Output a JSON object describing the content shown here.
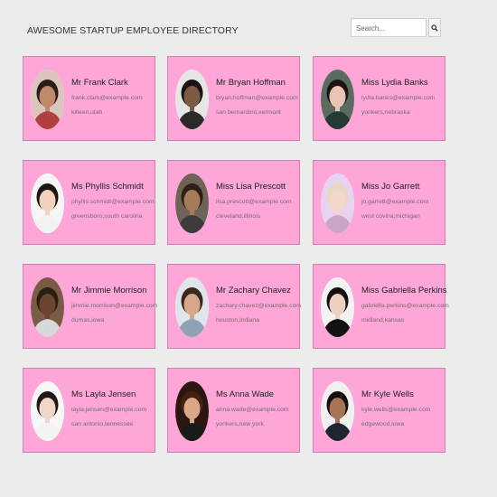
{
  "header": {
    "title": "AWESOME STARTUP EMPLOYEE DIRECTORY",
    "search_placeholder": "Search...",
    "search_icon": "magnifier-icon"
  },
  "employees": [
    {
      "name": "Mr Frank Clark",
      "email": "frank.clark@example.com",
      "location": "killeen,utah",
      "skin": "#c08a6a",
      "hair": "#2a1b14",
      "shirt": "#b04040",
      "bg": "#d9c6bd"
    },
    {
      "name": "Mr Bryan Hoffman",
      "email": "bryan.hoffman@example.com",
      "location": "san bernardino,vermont",
      "skin": "#7d5a44",
      "hair": "#181210",
      "shirt": "#2a2a2a",
      "bg": "#e6e6e6"
    },
    {
      "name": "Miss Lydia Banks",
      "email": "lydia.banks@example.com",
      "location": "yonkers,nebraska",
      "skin": "#e9c4b4",
      "hair": "#1c1512",
      "shirt": "#243a36",
      "bg": "#5a6b5f"
    },
    {
      "name": "Ms Phyllis Schmidt",
      "email": "phyllis.schmidt@example.com",
      "location": "greensboro,south carolina",
      "skin": "#f0d2bf",
      "hair": "#1b1513",
      "shirt": "#f2f2f2",
      "bg": "#f5f5f5"
    },
    {
      "name": "Miss Lisa Prescott",
      "email": "lisa.prescott@example.com",
      "location": "cleveland,illinois",
      "skin": "#a87a5c",
      "hair": "#2b1f18",
      "shirt": "#3b3b3b",
      "bg": "#6f6257"
    },
    {
      "name": "Miss Jo Garrett",
      "email": "jo.garrett@example.com",
      "location": "west covina,michigan",
      "skin": "#f1d6cc",
      "hair": "#e9d8c0",
      "shirt": "#c9a5c9",
      "bg": "#e9d2f0"
    },
    {
      "name": "Mr Jimmie Morrison",
      "email": "jimmie.morrison@example.com",
      "location": "dumas,iowa",
      "skin": "#6b4530",
      "hair": "#2b1c14",
      "shirt": "#d8d8d8",
      "bg": "#7a5b45"
    },
    {
      "name": "Mr Zachary Chavez",
      "email": "zachary.chavez@example.com",
      "location": "houston,indiana",
      "skin": "#d6a889",
      "hair": "#3a281c",
      "shirt": "#8fa1b6",
      "bg": "#dfe5ea"
    },
    {
      "name": "Miss Gabriella Perkins",
      "email": "gabriella.perkins@example.com",
      "location": "midland,kansas",
      "skin": "#ecd0c0",
      "hair": "#141010",
      "shirt": "#121212",
      "bg": "#f2f2f2"
    },
    {
      "name": "Ms Layla Jensen",
      "email": "layla.jensen@example.com",
      "location": "san antonio,tennessee",
      "skin": "#f1d5c6",
      "hair": "#1e1714",
      "shirt": "#f3f3f3",
      "bg": "#f7f7f7"
    },
    {
      "name": "Ms Anna Wade",
      "email": "anna.wade@example.com",
      "location": "yonkers,new york",
      "skin": "#d9a888",
      "hair": "#4a1f12",
      "shirt": "#1a1a1a",
      "bg": "#2b1612"
    },
    {
      "name": "Mr Kyle Wells",
      "email": "kyle.wells@example.com",
      "location": "edgewood,iowa",
      "skin": "#a77455",
      "hair": "#141010",
      "shirt": "#1f2430",
      "bg": "#eef0f2"
    }
  ]
}
